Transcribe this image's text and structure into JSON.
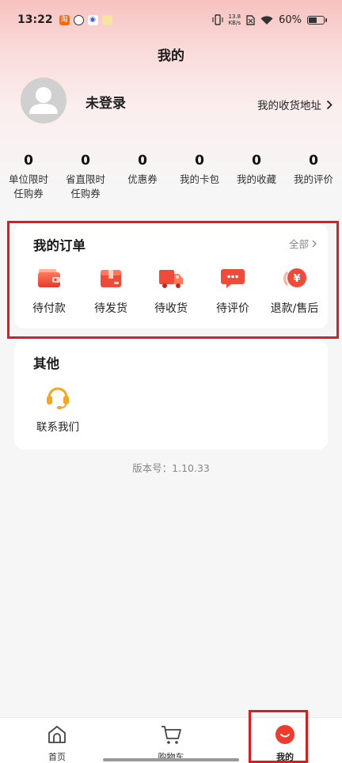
{
  "status_bar": {
    "time": "13:22",
    "net_speed_value": "13.8",
    "net_speed_unit": "KB/s",
    "battery": "60%",
    "battery_level": 0.6,
    "app_icons": [
      "taobao-icon",
      "app-icon-2",
      "baidu-icon",
      "app-icon-4"
    ]
  },
  "header": {
    "title": "我的"
  },
  "profile": {
    "login_status": "未登录",
    "address_link": "我的收货地址"
  },
  "stats": [
    {
      "value": "0",
      "label_line1": "单位限时",
      "label_line2": "任购券"
    },
    {
      "value": "0",
      "label_line1": "省直限时",
      "label_line2": "任购券"
    },
    {
      "value": "0",
      "label_line1": "优惠券",
      "label_line2": ""
    },
    {
      "value": "0",
      "label_line1": "我的卡包",
      "label_line2": ""
    },
    {
      "value": "0",
      "label_line1": "我的收藏",
      "label_line2": ""
    },
    {
      "value": "0",
      "label_line1": "我的评价",
      "label_line2": ""
    }
  ],
  "orders": {
    "title": "我的订单",
    "all_link": "全部",
    "items": [
      {
        "label": "待付款",
        "icon": "wallet-icon"
      },
      {
        "label": "待发货",
        "icon": "package-icon"
      },
      {
        "label": "待收货",
        "icon": "truck-icon"
      },
      {
        "label": "待评价",
        "icon": "comment-icon"
      },
      {
        "label": "退款/售后",
        "icon": "refund-icon"
      }
    ]
  },
  "other": {
    "title": "其他",
    "contact_label": "联系我们",
    "contact_icon": "headset-icon"
  },
  "version": "版本号：1.10.33",
  "tabs": [
    {
      "label": "首页",
      "icon": "home-icon"
    },
    {
      "label": "购物车",
      "icon": "cart-icon"
    },
    {
      "label": "我的",
      "icon": "profile-icon",
      "active": true
    }
  ],
  "colors": {
    "accent": "#f03a2b",
    "highlight": "#e11a22",
    "headset": "#f5a623"
  }
}
